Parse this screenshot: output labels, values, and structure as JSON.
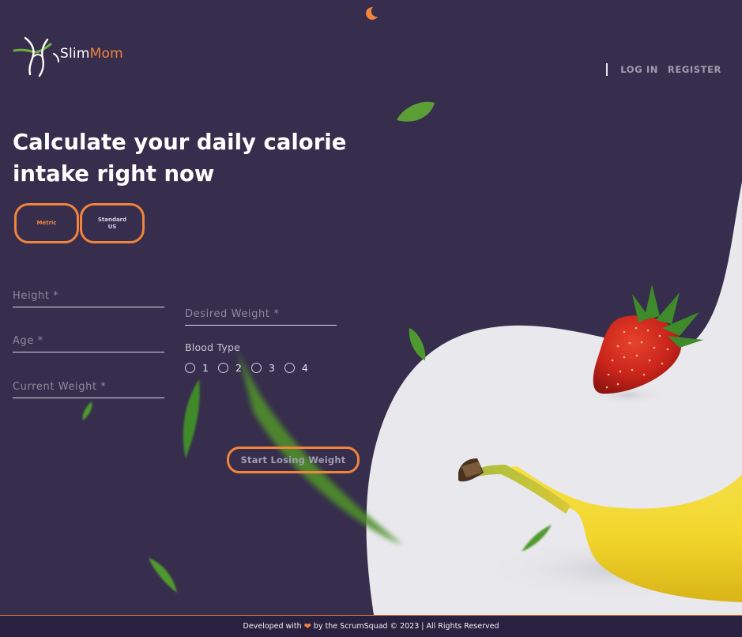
{
  "app": {
    "logo_slim": "Slim",
    "logo_mom": "Mom"
  },
  "nav": {
    "login": "LOG IN",
    "register": "REGISTER"
  },
  "icons": {
    "theme_toggle": "moon-icon",
    "logo_mark": "figure-icon",
    "heart": "heart-icon"
  },
  "main": {
    "headline": "Calculate your daily calorie intake right now",
    "units": {
      "metric": "Metric",
      "standard_line1": "Standard",
      "standard_line2": "US",
      "selected": "Metric"
    },
    "fields": {
      "height_placeholder": "Height *",
      "age_placeholder": "Age *",
      "current_weight_placeholder": "Current Weight *",
      "desired_weight_placeholder": "Desired Weight *"
    },
    "blood_type": {
      "label": "Blood Type",
      "options": [
        "1",
        "2",
        "3",
        "4"
      ]
    },
    "submit": "Start Losing Weight"
  },
  "footer": {
    "prefix": "Developed with",
    "suffix": "by the ScrumSquad © 2023 | All Rights Reserved"
  },
  "colors": {
    "background": "#372d4d",
    "accent": "#f0853b",
    "footer_bg": "#2a203f",
    "blob": "#e9e9ed",
    "leaf": "#5a9e35"
  }
}
